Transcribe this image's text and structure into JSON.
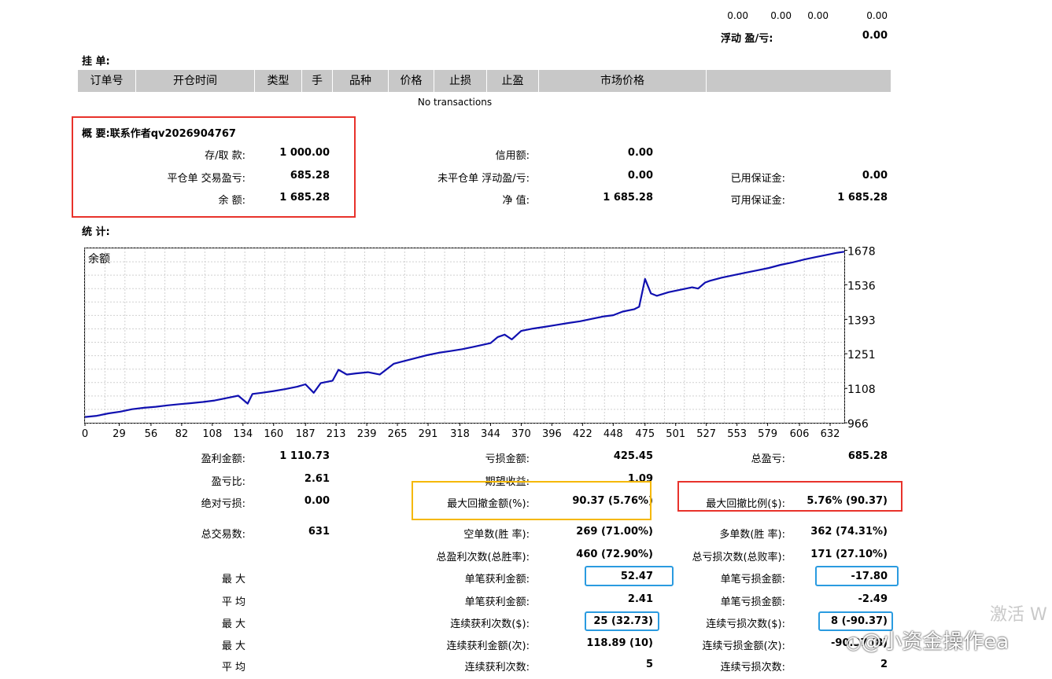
{
  "top": {
    "values": [
      "0.00",
      "0.00",
      "0.00",
      "0.00"
    ],
    "floating_label": "浮动 盈/亏:",
    "floating_value": "0.00"
  },
  "pending": {
    "title": "挂 单:",
    "columns": [
      "订单号",
      "开仓时间",
      "类型",
      "手",
      "品种",
      "价格",
      "止损",
      "止盈",
      "市场价格",
      ""
    ],
    "empty_text": "No transactions"
  },
  "summary": {
    "title": "概 要:联系作者qv2026904767",
    "deposit_label": "存/取 款:",
    "deposit_value": "1 000.00",
    "closed_pl_label": "平仓单 交易盈亏:",
    "closed_pl_value": "685.28",
    "balance_label": "余 额:",
    "balance_value": "1 685.28",
    "credit_label": "信用额:",
    "credit_value": "0.00",
    "open_pl_label": "未平仓单 浮动盈/亏:",
    "open_pl_value": "0.00",
    "equity_label": "净 值:",
    "equity_value": "1 685.28",
    "margin_label": "已用保证金:",
    "margin_value": "0.00",
    "free_margin_label": "可用保证金:",
    "free_margin_value": "1 685.28"
  },
  "stats_title": "统 计:",
  "chart_data": {
    "type": "line",
    "title": "余额",
    "xlabel": "",
    "ylabel": "",
    "x_ticks": [
      0,
      29,
      56,
      82,
      108,
      134,
      160,
      187,
      213,
      239,
      265,
      291,
      318,
      344,
      370,
      396,
      422,
      448,
      475,
      501,
      527,
      553,
      579,
      606,
      632
    ],
    "y_ticks": [
      966,
      1108,
      1251,
      1393,
      1536,
      1678
    ],
    "xlim": [
      0,
      644
    ],
    "ylim": [
      966,
      1686
    ],
    "grid": true,
    "legend": "none",
    "color": "#1010b0",
    "series": [
      {
        "x": [
          0,
          10,
          20,
          30,
          40,
          50,
          60,
          70,
          80,
          90,
          100,
          110,
          120,
          130,
          138,
          142,
          150,
          160,
          170,
          180,
          187,
          194,
          200,
          210,
          215,
          222,
          230,
          240,
          250,
          262,
          270,
          282,
          290,
          300,
          310,
          320,
          330,
          344,
          350,
          356,
          362,
          370,
          380,
          390,
          400,
          410,
          420,
          430,
          440,
          448,
          456,
          466,
          470,
          475,
          480,
          485,
          495,
          505,
          515,
          520,
          526,
          530,
          540,
          550,
          560,
          570,
          580,
          590,
          600,
          610,
          620,
          632,
          638,
          644
        ],
        "y": [
          990,
          995,
          1005,
          1012,
          1022,
          1028,
          1032,
          1038,
          1043,
          1047,
          1052,
          1058,
          1068,
          1078,
          1045,
          1085,
          1090,
          1097,
          1105,
          1115,
          1125,
          1090,
          1130,
          1140,
          1185,
          1165,
          1170,
          1175,
          1165,
          1210,
          1220,
          1235,
          1245,
          1255,
          1262,
          1270,
          1280,
          1295,
          1320,
          1330,
          1310,
          1345,
          1355,
          1362,
          1370,
          1378,
          1385,
          1395,
          1405,
          1410,
          1425,
          1435,
          1445,
          1560,
          1500,
          1490,
          1505,
          1515,
          1525,
          1520,
          1545,
          1552,
          1565,
          1575,
          1585,
          1595,
          1605,
          1618,
          1628,
          1640,
          1650,
          1662,
          1668,
          1672
        ]
      }
    ]
  },
  "stats": {
    "rows": [
      {
        "c1l": "盈利金额:",
        "c1v": "1 110.73",
        "c2l": "亏损金额:",
        "c2v": "425.45",
        "c3l": "总盈亏:",
        "c3v": "685.28"
      },
      {
        "c1l": "盈亏比:",
        "c1v": "2.61",
        "c2l": "期望收益:",
        "c2v": "1.09",
        "c3l": "",
        "c3v": ""
      },
      {
        "c1l": "绝对亏损:",
        "c1v": "0.00",
        "c2l": "最大回撤金额(%):",
        "c2v": "90.37 (5.76%)",
        "c3l": "最大回撤比例($):",
        "c3v": "5.76% (90.37)"
      },
      {
        "c1l": "总交易数:",
        "c1v": "631",
        "c2l": "空单数(胜 率):",
        "c2v": "269 (71.00%)",
        "c3l": "多单数(胜 率):",
        "c3v": "362 (74.31%)"
      },
      {
        "c1l": "",
        "c1v": "",
        "c2l": "总盈利次数(总胜率):",
        "c2v": "460 (72.90%)",
        "c3l": "总亏损次数(总败率):",
        "c3v": "171 (27.10%)"
      },
      {
        "c1l": "最 大",
        "c1v": "",
        "c2l": "单笔获利金额:",
        "c2v": "52.47",
        "c3l": "单笔亏损金额:",
        "c3v": "-17.80"
      },
      {
        "c1l": "平 均",
        "c1v": "",
        "c2l": "单笔获利金额:",
        "c2v": "2.41",
        "c3l": "单笔亏损金额:",
        "c3v": "-2.49"
      },
      {
        "c1l": "最 大",
        "c1v": "",
        "c2l": "连续获利次数($):",
        "c2v": "25 (32.73)",
        "c3l": "连续亏损次数($):",
        "c3v": "8 (-90.37)"
      },
      {
        "c1l": "最 大",
        "c1v": "",
        "c2l": "连续获利金额(次):",
        "c2v": "118.89 (10)",
        "c3l": "连续亏损金额(次):",
        "c3v": "-90.37 (8)"
      },
      {
        "c1l": "平 均",
        "c1v": "",
        "c2l": "连续获利次数:",
        "c2v": "5",
        "c3l": "连续亏损次数:",
        "c3v": "2"
      }
    ]
  },
  "colors": {
    "red_box": "#e8322b",
    "orange_box": "#f5b800",
    "blue_box": "#2a9be0",
    "header_bg": "#c8c8c8"
  },
  "watermark": {
    "activate": "激活 W",
    "source": "@小资金操作ea"
  }
}
